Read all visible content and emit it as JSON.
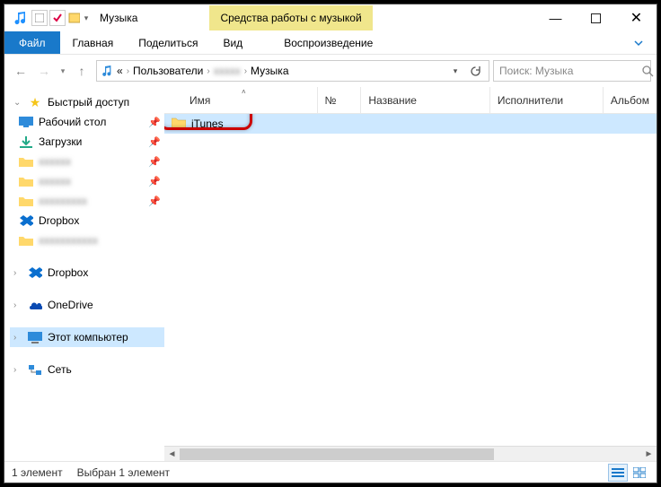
{
  "title": "Музыка",
  "context_tab": "Средства работы с музыкой",
  "ribbon": {
    "file": "Файл",
    "home": "Главная",
    "share": "Поделиться",
    "view": "Вид",
    "play": "Воспроизведение"
  },
  "breadcrumbs": {
    "root_glyph": "«",
    "users": "Пользователи",
    "user_blur": "xxxxx",
    "music": "Музыка"
  },
  "search": {
    "placeholder": "Поиск: Музыка"
  },
  "navpane": {
    "quick_access": "Быстрый доступ",
    "items": [
      {
        "label": "Рабочий стол",
        "icon": "desktop"
      },
      {
        "label": "Загрузки",
        "icon": "downloads"
      },
      {
        "label": "xxxxxx",
        "icon": "folder",
        "blur": true
      },
      {
        "label": "xxxxxx",
        "icon": "folder",
        "blur": true
      },
      {
        "label": "xxxxxxxxx",
        "icon": "folder",
        "blur": true
      },
      {
        "label": "Dropbox",
        "icon": "dropbox"
      },
      {
        "label": "xxxxxxxxxxx",
        "icon": "folder",
        "blur": true
      }
    ],
    "dropbox": "Dropbox",
    "onedrive": "OneDrive",
    "this_pc": "Этот компьютер",
    "network": "Сеть"
  },
  "columns": {
    "name": "Имя",
    "number": "№",
    "title": "Название",
    "artists": "Исполнители",
    "album": "Альбом"
  },
  "files": [
    {
      "name": "iTunes",
      "type": "folder",
      "selected": true
    }
  ],
  "status": {
    "count": "1 элемент",
    "selection": "Выбран 1 элемент"
  }
}
